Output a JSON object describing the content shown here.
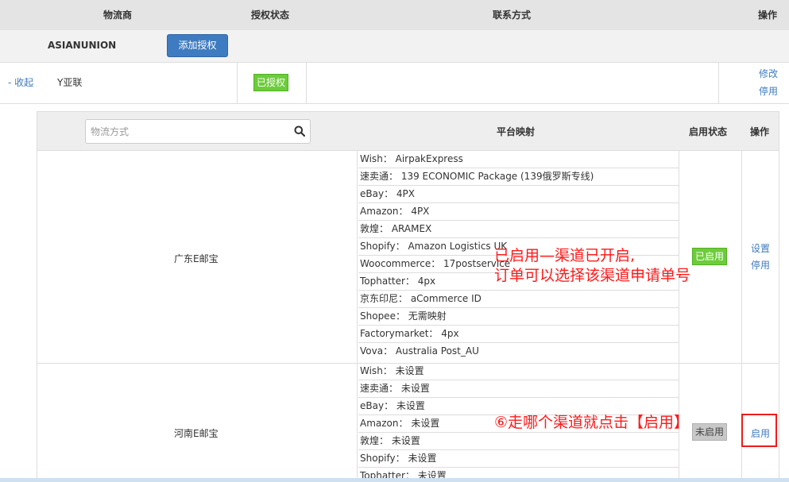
{
  "header": {
    "col_provider": "物流商",
    "col_auth_status": "授权状态",
    "col_contact": "联系方式",
    "col_action": "操作"
  },
  "provider": {
    "name": "ASIANUNION",
    "add_auth_label": "添加授权"
  },
  "account": {
    "collapse_label": "- 收起",
    "name": "Y亚联",
    "auth_status": "已授权",
    "edit_label": "修改",
    "disable_label": "停用"
  },
  "channels_table": {
    "search_placeholder": "物流方式",
    "col_mapping": "平台映射",
    "col_status": "启用状态",
    "col_action": "操作",
    "rows": [
      {
        "method": "广东E邮宝",
        "mappings": [
          "Wish： AirpakExpress",
          "速卖通： 139 ECONOMIC Package (139俄罗斯专线)",
          "eBay： 4PX",
          "Amazon： 4PX",
          "敦煌： ARAMEX",
          "Shopify： Amazon Logistics UK",
          "Woocommerce： 17postservice",
          "Tophatter： 4px",
          "京东印尼： aCommerce ID",
          "Shopee： 无需映射",
          "Factorymarket： 4px",
          "Vova： Australia Post_AU"
        ],
        "status": "已启用",
        "action_1": "设置",
        "action_2": "停用"
      },
      {
        "method": "河南E邮宝",
        "mappings": [
          "Wish： 未设置",
          "速卖通： 未设置",
          "eBay： 未设置",
          "Amazon： 未设置",
          "敦煌： 未设置",
          "Shopify： 未设置",
          "Tophatter： 未设置"
        ],
        "status": "未启用",
        "action_1": "启用"
      }
    ]
  },
  "annotations": {
    "enabled_note_line1": "已启用—渠道已开启,",
    "enabled_note_line2": "订单可以选择该渠道申请单号",
    "step_note": "⑥走哪个渠道就点击【启用】"
  },
  "colors": {
    "link_blue": "#3f7bc0",
    "button_blue": "#3f7bc0",
    "enabled_green": "#6ccc3a",
    "annotation_red": "#ff1a1a"
  }
}
